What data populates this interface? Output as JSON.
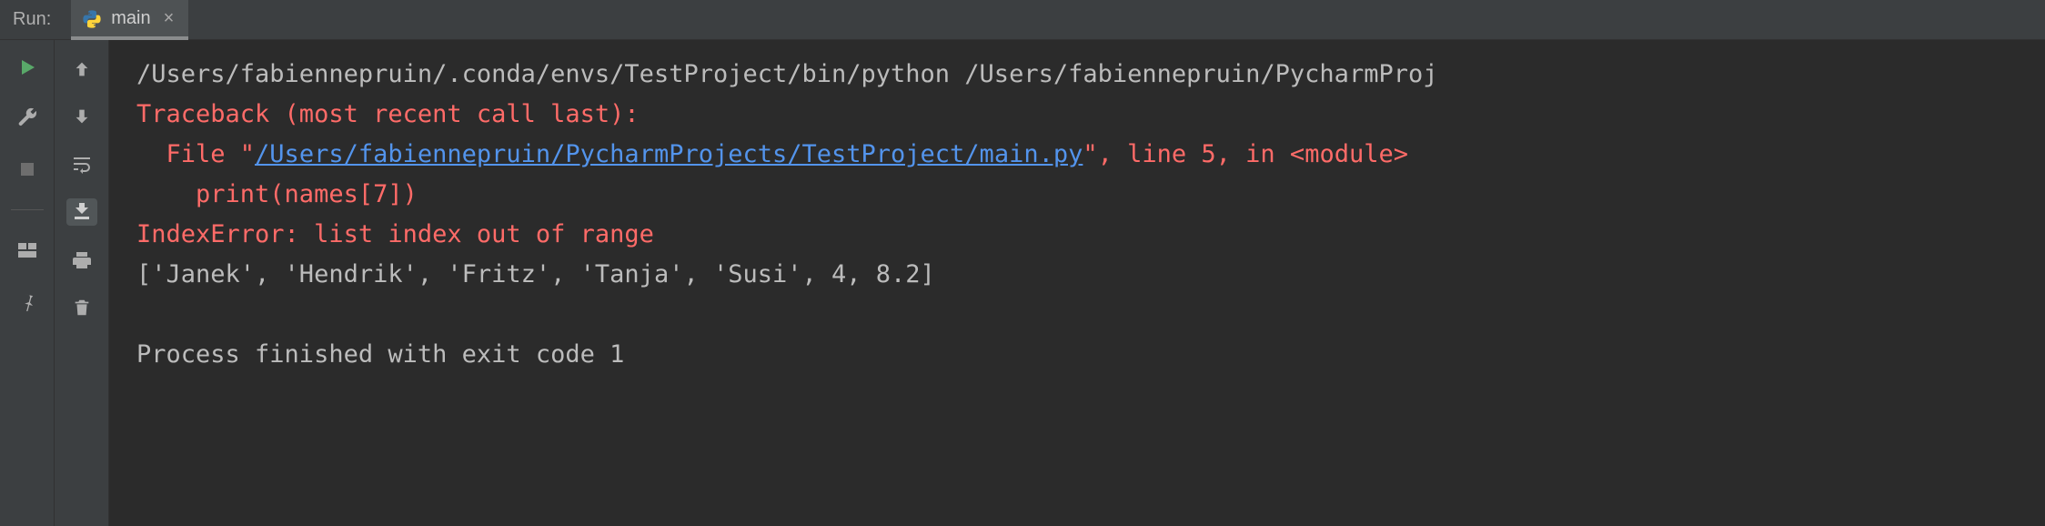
{
  "header": {
    "run_label": "Run:",
    "tab_label": "main",
    "close_glyph": "×"
  },
  "console": {
    "cmd": "/Users/fabiennepruin/.conda/envs/TestProject/bin/python /Users/fabiennepruin/PycharmProj",
    "traceback_header": "Traceback (most recent call last):",
    "file_prefix": "  File \"",
    "file_link": "/Users/fabiennepruin/PycharmProjects/TestProject/main.py",
    "file_suffix": "\", line 5, in <module>",
    "code_line": "    print(names[7])",
    "error_line": "IndexError: list index out of range",
    "data_line": "['Janek', 'Hendrik', 'Fritz', 'Tanja', 'Susi', 4, 8.2]",
    "blank": "",
    "exit_line": "Process finished with exit code 1"
  }
}
